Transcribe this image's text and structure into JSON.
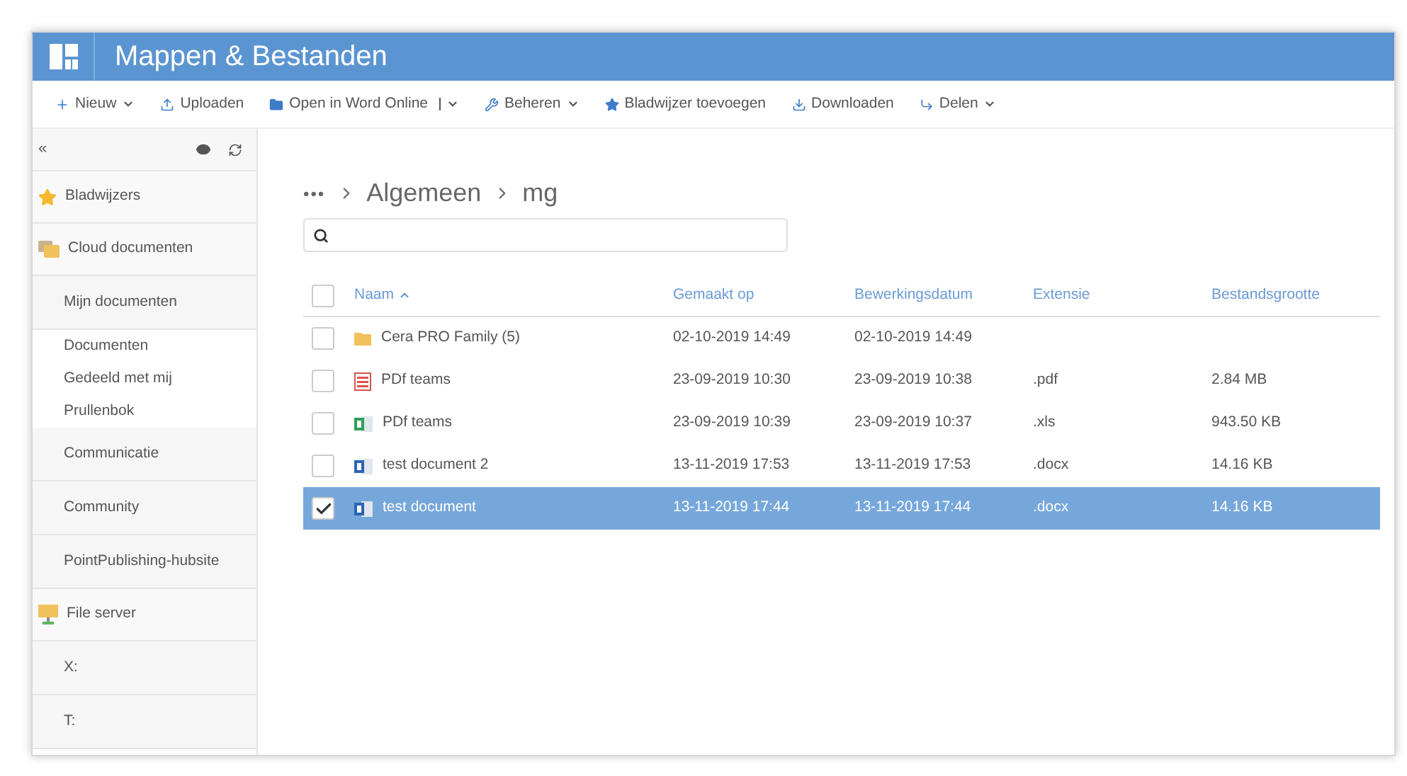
{
  "app": {
    "title": "Mappen & Bestanden"
  },
  "toolbar": [
    {
      "label": "Nieuw",
      "caret": true,
      "split": false
    },
    {
      "label": "Uploaden",
      "caret": false,
      "split": false
    },
    {
      "label": "Open in Word Online",
      "caret": true,
      "split": true
    },
    {
      "label": "Beheren",
      "caret": true,
      "split": false
    },
    {
      "label": "Bladwijzer toevoegen",
      "caret": false,
      "split": false
    },
    {
      "label": "Downloaden",
      "caret": false,
      "split": false
    },
    {
      "label": "Delen",
      "caret": true,
      "split": false
    }
  ],
  "sidebar": {
    "collapse": "«",
    "items": [
      {
        "kind": "section",
        "label": "Bladwijzers"
      },
      {
        "kind": "section",
        "label": "Cloud documenten"
      },
      {
        "kind": "site",
        "label": "Mijn documenten"
      },
      {
        "kind": "link",
        "label": "Documenten"
      },
      {
        "kind": "link",
        "label": "Gedeeld met mij"
      },
      {
        "kind": "link",
        "label": "Prullenbok"
      },
      {
        "kind": "site",
        "label": "Communicatie"
      },
      {
        "kind": "site",
        "label": "Community"
      },
      {
        "kind": "site",
        "label": "PointPublishing-hubsite"
      },
      {
        "kind": "section",
        "label": "File server"
      },
      {
        "kind": "site",
        "label": "X:"
      },
      {
        "kind": "site",
        "label": "T:"
      }
    ]
  },
  "breadcrumb": [
    "•••",
    "Algemeen",
    "mg"
  ],
  "table": {
    "all_selected": false,
    "columns": [
      "Naam",
      "Gemaakt op",
      "Bewerkingsdatum",
      "Extensie",
      "Bestandsgrootte"
    ],
    "rows": [
      {
        "kind": "folder",
        "name": "Cera PRO Family (5)",
        "created": "02-10-2019 14:49",
        "modified": "02-10-2019 14:49",
        "selected": false
      },
      {
        "kind": "pdf",
        "name": "PDf teams",
        "created": "23-09-2019 10:30",
        "modified": "23-09-2019 10:38",
        "extension": ".pdf",
        "size": "2.84 MB",
        "selected": false
      },
      {
        "kind": "excel",
        "name": "PDf teams",
        "created": "23-09-2019 10:39",
        "modified": "23-09-2019 10:37",
        "extension": ".xls",
        "size": "943.50 KB",
        "selected": false
      },
      {
        "kind": "word",
        "name": "test document 2",
        "created": "13-11-2019 17:53",
        "modified": "13-11-2019 17:53",
        "extension": ".docx",
        "size": "14.16 KB",
        "selected": false
      },
      {
        "kind": "word",
        "name": "test document",
        "created": "13-11-2019 17:44",
        "modified": "13-11-2019 17:44",
        "extension": ".docx",
        "size": "14.16 KB",
        "selected": true
      }
    ]
  }
}
